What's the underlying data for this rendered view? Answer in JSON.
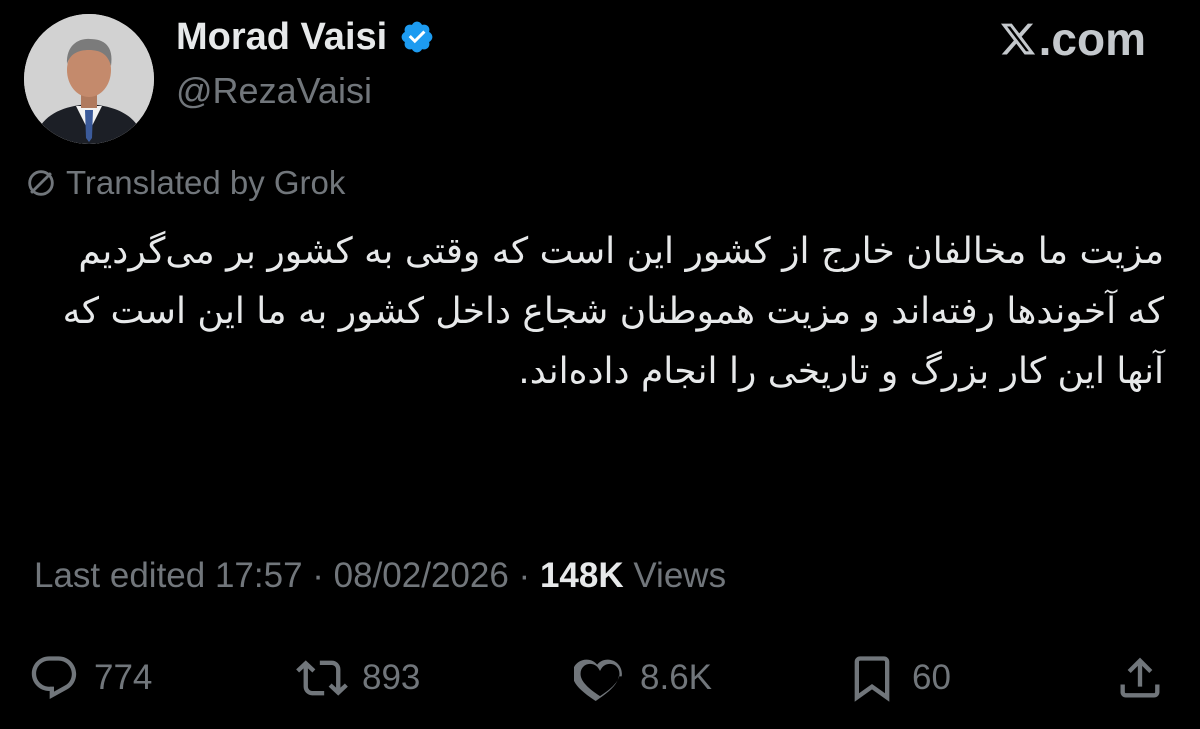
{
  "author": {
    "display_name": "Morad Vaisi",
    "handle": "@RezaVaisi",
    "avatar_icon": "profile-photo",
    "verified_color": "#1d9bf0"
  },
  "site": {
    "label": ".com",
    "logo_icon": "x-logo"
  },
  "translation": {
    "label": "Translated by Grok",
    "icon": "slash-circle-icon"
  },
  "tweet": {
    "text": "مزیت ما مخالفان خارج از کشور این است که وقتی به کشور بر می‌گردیم که آخوندها رفته‌اند و مزیت هموطنان شجاع داخل کشور به ما این است که آنها این کار بزرگ و تاریخی را انجام داده‌اند."
  },
  "meta": {
    "edited_prefix": "Last edited 17:57 · 08/02/2026  · ",
    "views_count": "148K",
    "views_label": " Views"
  },
  "actions": {
    "replies": "774",
    "reposts": "893",
    "likes": "8.6K",
    "bookmarks": "60"
  },
  "colors": {
    "background": "#000000",
    "text_primary": "#e7e9ea",
    "text_secondary": "#71767b"
  }
}
